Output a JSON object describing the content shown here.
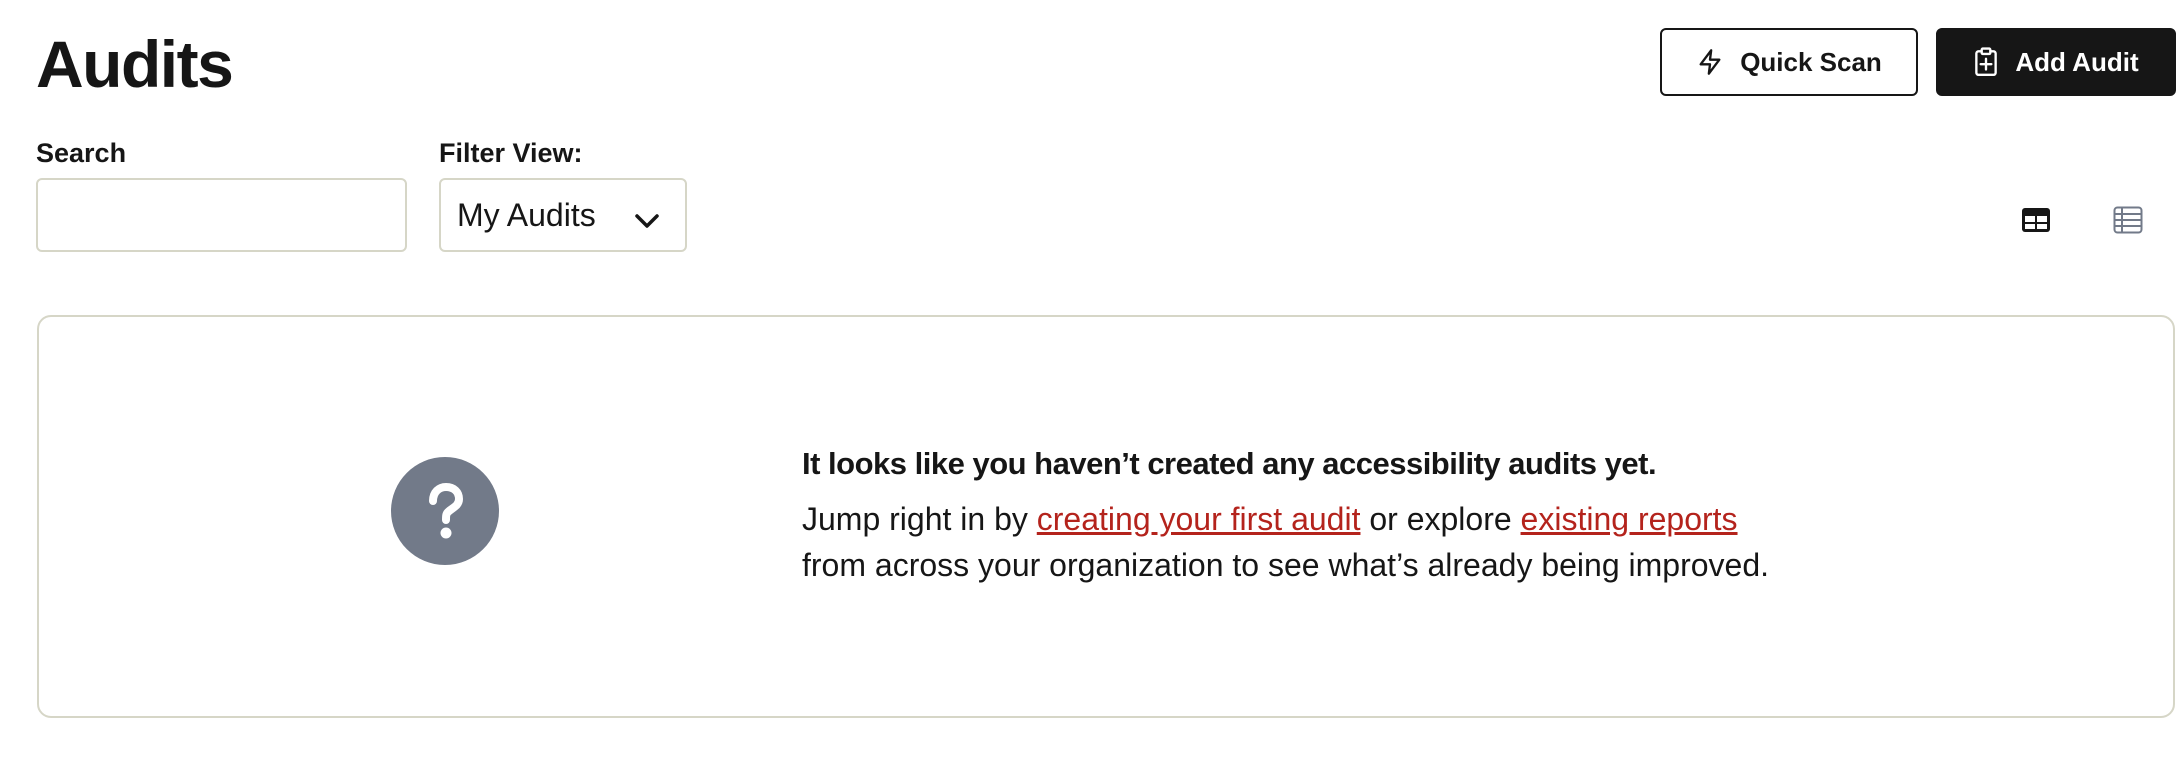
{
  "header": {
    "title": "Audits",
    "quick_scan_label": "Quick Scan",
    "add_audit_label": "Add Audit"
  },
  "filters": {
    "search_label": "Search",
    "search_value": "",
    "filter_label": "Filter View:",
    "filter_value": "My Audits"
  },
  "view_toggles": {
    "grid_icon": "table-grid-icon",
    "list_icon": "list-icon"
  },
  "empty_state": {
    "icon": "question-icon",
    "heading": "It looks like you haven’t created any accessibility audits yet.",
    "body_prefix": "Jump right in by ",
    "link_create": "creating your first audit",
    "body_middle": " or explore ",
    "link_reports": "existing reports",
    "body_suffix": "from across your organization to see what’s already being improved."
  },
  "colors": {
    "text": "#161616",
    "border": "#d6d6c7",
    "link": "#b4231c",
    "help_circle": "#727a89",
    "primary_button": "#161616"
  }
}
